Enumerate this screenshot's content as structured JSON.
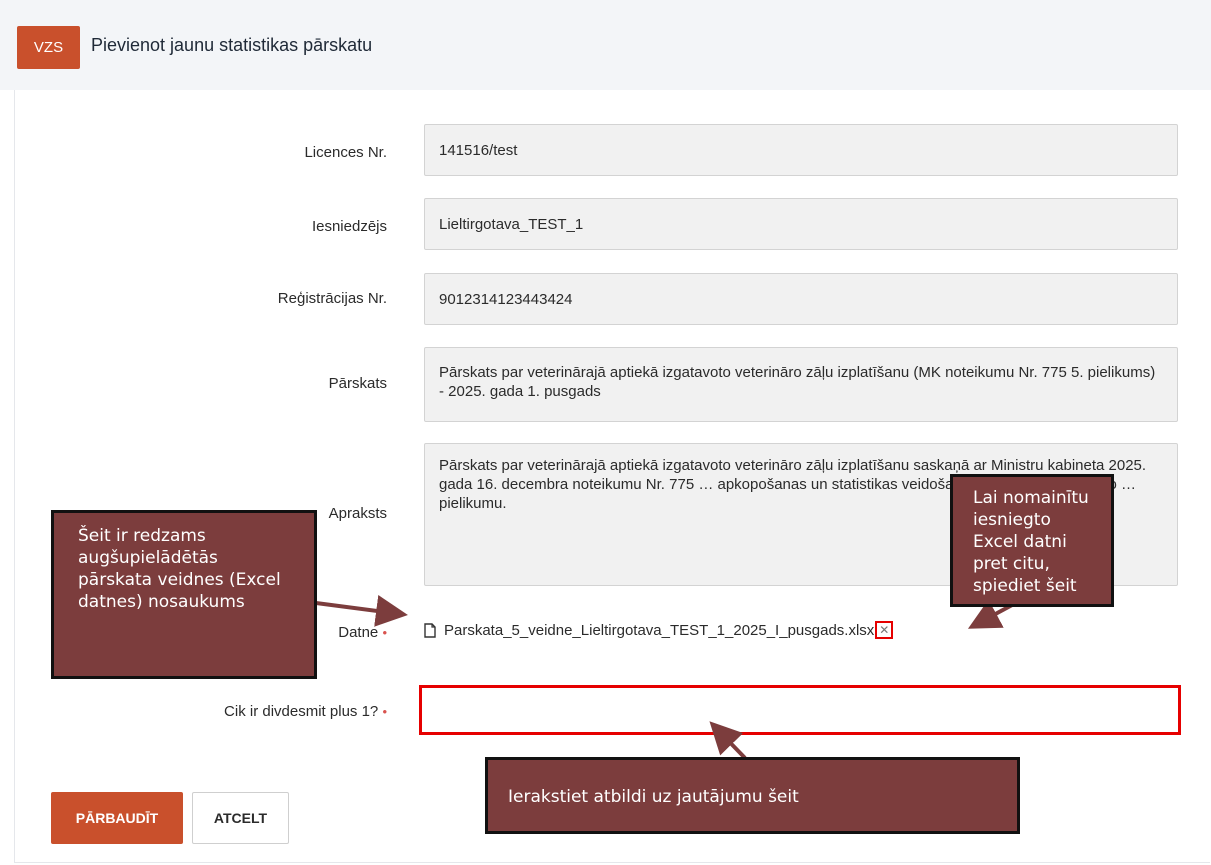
{
  "header": {
    "logo": "VZS",
    "title": "Pievienot jaunu statistikas pārskatu"
  },
  "form": {
    "licence": {
      "label": "Licences Nr.",
      "value": "141516/test"
    },
    "submitter": {
      "label": "Iesniedzējs",
      "value": "Lieltirgotava_TEST_1"
    },
    "registration": {
      "label": "Reģistrācijas Nr.",
      "value": "9012314123443424"
    },
    "report": {
      "label": "Pārskats",
      "value": "Pārskats par veterinārajā aptiekā izgatavoto veterināro zāļu izplatīšanu (MK noteikumu Nr. 775 5. pielikums) - 2025. gada 1. pusgads"
    },
    "description": {
      "label": "Apraksts",
      "value": "Pārskats par veterinārajā aptiekā izgatavoto veterināro zāļu izplatīšanu saskaņā ar Ministru kabineta 2025. gada 16. decembra noteikumu Nr. 775 … apkopošanas un statistikas veidošanas noteikumi veterināro … pielikumu."
    },
    "file": {
      "label": "Datne",
      "name": "Parskata_5_veidne_Lieltirgotava_TEST_1_2025_I_pusgads.xlsx",
      "icon": "file-icon",
      "remove_icon": "close-icon",
      "remove_glyph": "✕"
    },
    "captcha": {
      "label": "Cik ir divdesmit plus 1?",
      "value": "",
      "placeholder": ""
    },
    "required_mark": "•"
  },
  "actions": {
    "check": "PĀRBAUDĪT",
    "cancel": "ATCELT"
  },
  "callouts": {
    "file_name": "Šeit ir redzams augšupielādētās pārskata veidnes (Excel datnes) nosaukums",
    "replace_file": "Lai nomainītu iesniegto Excel datni pret citu, spiediet šeit",
    "answer": "Ierakstiet atbildi uz jautājumu šeit"
  },
  "colors": {
    "brand": "#c9502c",
    "highlight": "#e60000",
    "callout_bg": "#7c3d3d"
  }
}
